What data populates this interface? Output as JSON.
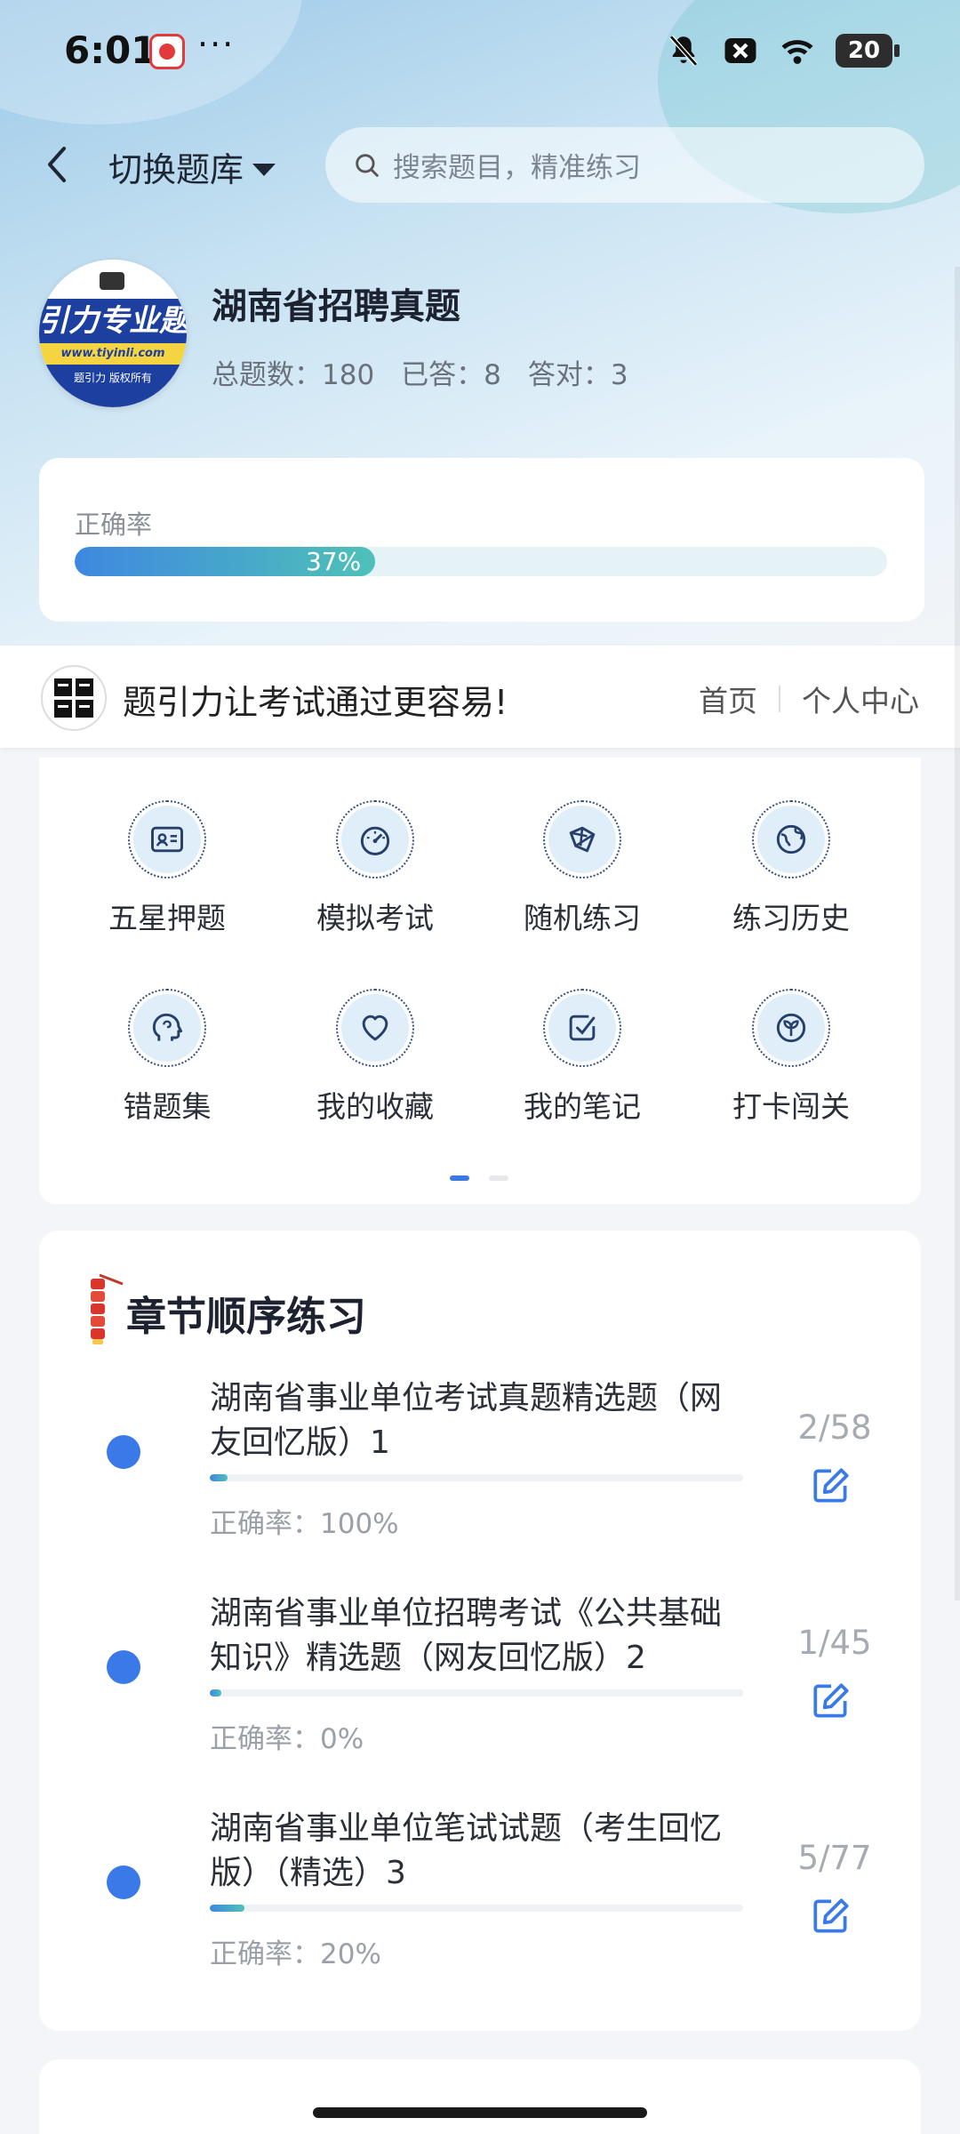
{
  "status_bar": {
    "time": "6:01",
    "more": "···",
    "battery": "20"
  },
  "nav": {
    "switch_bank_label": "切换题库",
    "search_placeholder": "搜索题目，精准练习"
  },
  "bank": {
    "logo_text": "引力专业题",
    "logo_url": "www.tiyinli.com",
    "logo_copyright": "题引力 版权所有",
    "title": "湖南省招聘真题",
    "stats": {
      "total": "总题数：180",
      "answered": "已答：8",
      "correct": "答对：3"
    }
  },
  "accuracy": {
    "label": "正确率",
    "percent_text": "37%",
    "percent": 37
  },
  "banner": {
    "logo_text": "题引力",
    "slogan": "题引力让考试通过更容易!",
    "home_link": "首页",
    "personal_link": "个人中心"
  },
  "grid_menu": {
    "items": [
      {
        "label": "五星押题",
        "icon": "id-card-icon"
      },
      {
        "label": "模拟考试",
        "icon": "speedometer-icon"
      },
      {
        "label": "随机练习",
        "icon": "shuffle-icon"
      },
      {
        "label": "练习历史",
        "icon": "globe-icon"
      },
      {
        "label": "错题集",
        "icon": "brain-head-icon"
      },
      {
        "label": "我的收藏",
        "icon": "heart-icon"
      },
      {
        "label": "我的笔记",
        "icon": "note-check-icon"
      },
      {
        "label": "打卡闯关",
        "icon": "sprout-icon"
      }
    ],
    "pager": {
      "pages": 2,
      "active": 0
    }
  },
  "chapters": {
    "title": "章节顺序练习",
    "items": [
      {
        "name": "湖南省事业单位考试真题精选题（网友回忆版）1",
        "count": "2/58",
        "accuracy": "正确率：100%",
        "progress": 0.034
      },
      {
        "name": "湖南省事业单位招聘考试《公共基础知识》精选题（网友回忆版）2",
        "count": "1/45",
        "accuracy": "正确率：0%",
        "progress": 0.022
      },
      {
        "name": "湖南省事业单位笔试试题（考生回忆版）（精选）3",
        "count": "5/77",
        "accuracy": "正确率：20%",
        "progress": 0.065
      }
    ]
  },
  "colors": {
    "accent": "#3a7ae8",
    "progress_start": "#3e88e0",
    "progress_end": "#4fc1b8"
  }
}
